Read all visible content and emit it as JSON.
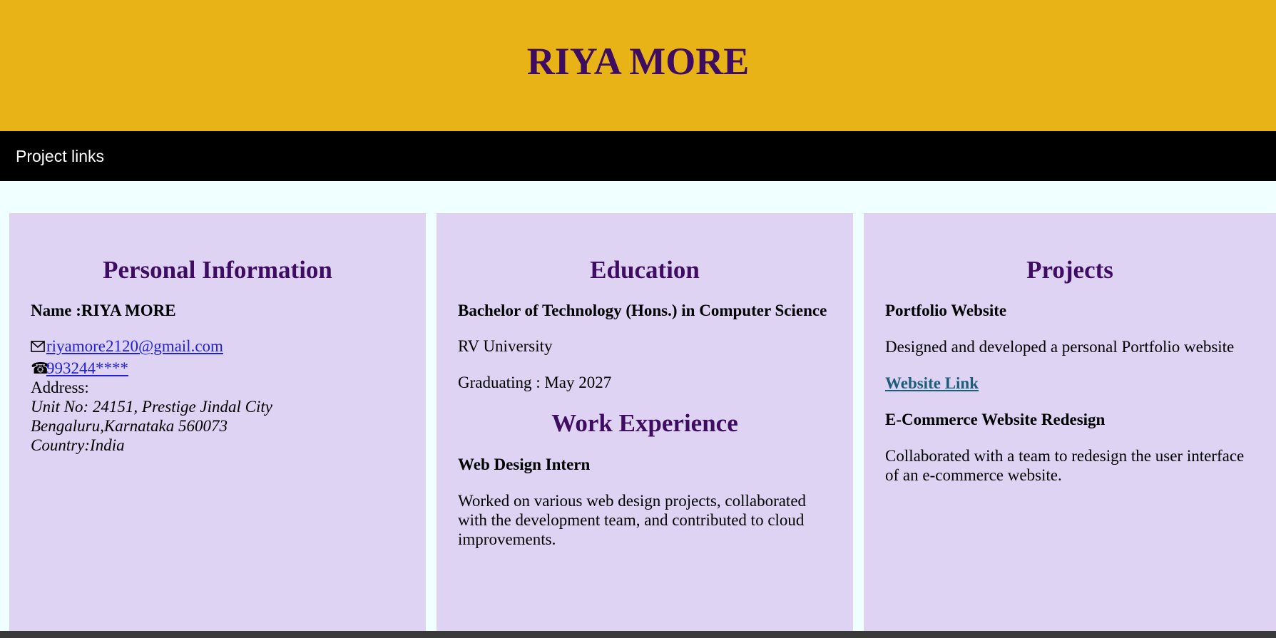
{
  "header": {
    "title": "RIYA MORE"
  },
  "nav": {
    "link_label": "Project links"
  },
  "personal": {
    "heading": "Personal Information",
    "name_label": "Name :RIYA MORE",
    "email": "riyamore2120@gmail.com",
    "phone": "993244****",
    "address_label": "Address:",
    "address_lines": [
      "Unit No: 24151, Prestige Jindal City",
      "Bengaluru,Karnataka 560073",
      "Country:India"
    ]
  },
  "education": {
    "heading": "Education",
    "degree": "Bachelor of Technology (Hons.) in Computer Science",
    "university": "RV University",
    "graduation": "Graduating : May 2027"
  },
  "work": {
    "heading": "Work Experience",
    "role": "Web Design Intern",
    "description": "Worked on various web design projects, collaborated with the development team, and contributed to cloud improvements."
  },
  "projects": {
    "heading": "Projects",
    "items": [
      {
        "title": "Portfolio Website",
        "description": "Designed and developed a personal Portfolio website",
        "link": "Website Link"
      },
      {
        "title": "E-Commerce Website Redesign",
        "description": "Collaborated with a team to redesign the user interface of an e-commerce website."
      }
    ]
  },
  "icons": {
    "email": "envelope-icon",
    "phone": "telephone-icon"
  },
  "colors": {
    "header_bg": "#E8B316",
    "heading": "#3E0C60",
    "card_bg": "#DED3F3",
    "nav_bg": "#000000",
    "page_bg": "#F0FFFF"
  }
}
